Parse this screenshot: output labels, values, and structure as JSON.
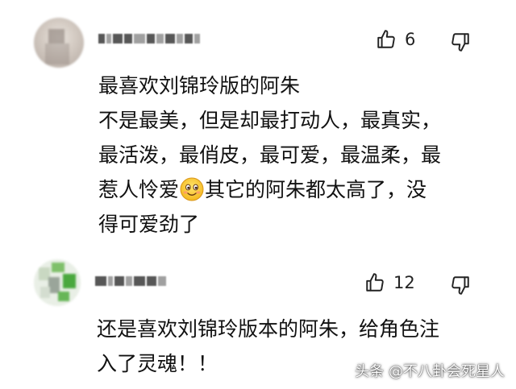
{
  "comments": [
    {
      "username": "",
      "likes": "6",
      "lines": [
        "最喜欢刘锦玲版的阿朱",
        "不是最美，但是却最打动人，最真实，",
        "最活泼，最俏皮，最可爱，最温柔，最"
      ],
      "line4_before": "惹人怜爱",
      "emoji": "smiling-face-emoji",
      "line4_after": "其它的阿朱都太高了，没",
      "line5": "得可爱劲了"
    },
    {
      "username": "",
      "likes": "12",
      "lines": [
        "还是喜欢刘锦玲版本的阿朱，给角色注",
        "入了灵魂！！"
      ]
    }
  ],
  "icons": {
    "like": "thumbs-up-icon",
    "dislike": "thumbs-down-icon"
  },
  "watermark": "头条 @不八卦会死星人",
  "colors": {
    "text": "#111111",
    "background": "#ffffff",
    "icon": "#222222"
  }
}
